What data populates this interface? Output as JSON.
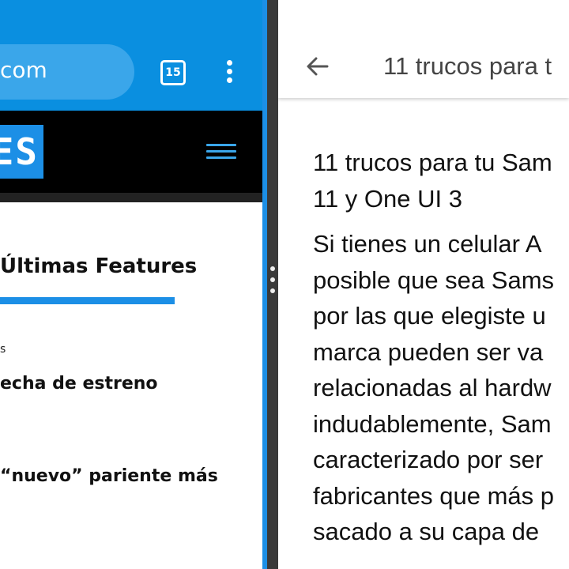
{
  "browser": {
    "url_text": "com",
    "tab_count": "15"
  },
  "site": {
    "logo_text": "ES",
    "section_title": "Últimas Features",
    "category_label": "s",
    "articles": [
      {
        "title": "echa de estreno"
      },
      {
        "title": "“nuevo” pariente más"
      }
    ]
  },
  "reader": {
    "header_title": "11 trucos para t",
    "title_lines": [
      "11 trucos para tu Sam",
      "11 y One UI 3"
    ],
    "body_lines": [
      "Si tienes un celular A",
      "posible que sea Sams",
      "por las que elegiste u",
      "marca pueden ser va",
      "relacionadas al hardw",
      "indudablemente, Sam",
      "caracterizado por ser",
      "fabricantes que más p",
      "sacado a su capa de"
    ]
  },
  "colors": {
    "chrome_blue": "#0a8fe0",
    "accent_blue": "#1c8fe6",
    "divider": "#3a3a3a"
  }
}
